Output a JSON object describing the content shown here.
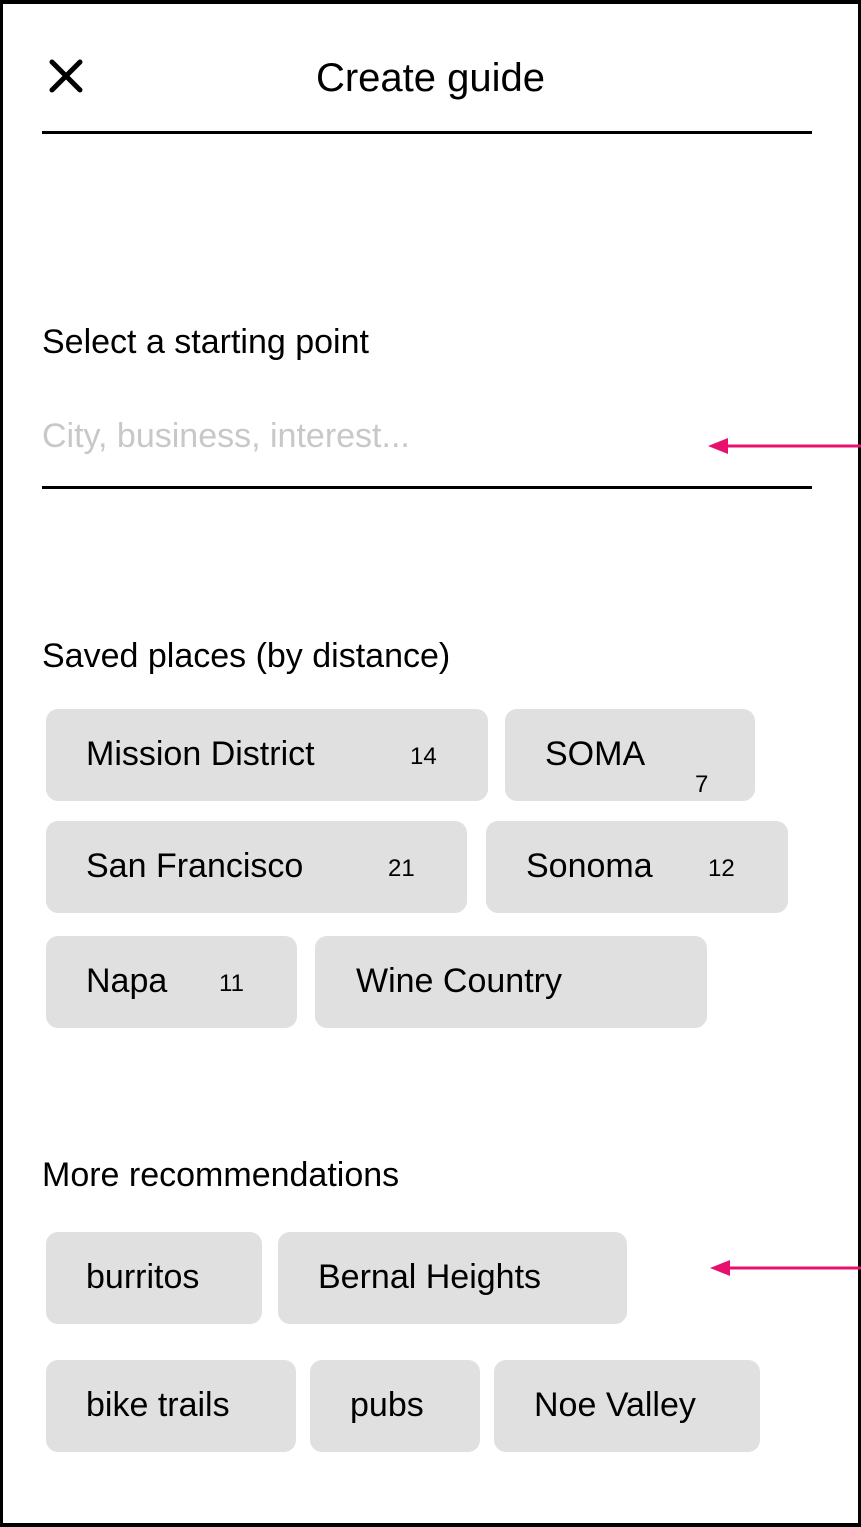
{
  "header": {
    "title": "Create guide",
    "close_icon": "close-icon"
  },
  "search": {
    "label": "Select a starting point",
    "value": "",
    "placeholder": "City, business, interest..."
  },
  "saved_places": {
    "heading": "Saved places (by distance)",
    "items": [
      {
        "label": "Mission District",
        "count": "14"
      },
      {
        "label": "SOMA",
        "count": "7"
      },
      {
        "label": "San Francisco",
        "count": "21"
      },
      {
        "label": "Sonoma",
        "count": "12"
      },
      {
        "label": "Napa",
        "count": "11"
      },
      {
        "label": "Wine Country",
        "count": ""
      }
    ]
  },
  "recommendations": {
    "heading": "More recommendations",
    "items": [
      {
        "label": "burritos"
      },
      {
        "label": "Bernal Heights"
      },
      {
        "label": "bike trails"
      },
      {
        "label": "pubs"
      },
      {
        "label": "Noe Valley"
      }
    ]
  },
  "colors": {
    "chip_bg": "#e0e0e0",
    "placeholder": "#c8c8c8",
    "annotation_arrow": "#e8106e"
  }
}
